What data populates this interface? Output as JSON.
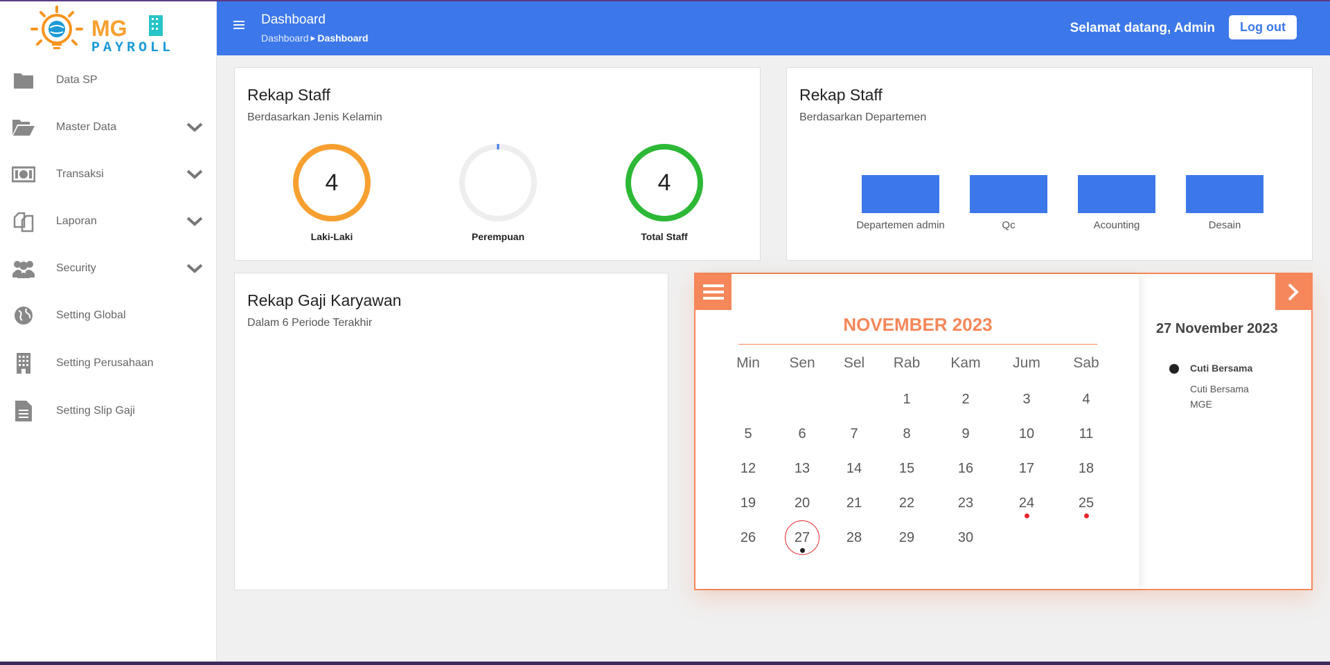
{
  "brand": {
    "logo_text_top": "MG",
    "logo_text_bottom": "PAYROLL",
    "colors": {
      "orange": "#f7941d",
      "blue": "#1b9ad6",
      "teal": "#27c4c8"
    }
  },
  "sidebar": {
    "items": [
      {
        "label": "Data SP",
        "icon": "folder-icon",
        "has_chevron": false
      },
      {
        "label": "Master Data",
        "icon": "folder-open-icon",
        "has_chevron": true
      },
      {
        "label": "Transaksi",
        "icon": "money-icon",
        "has_chevron": true
      },
      {
        "label": "Laporan",
        "icon": "copy-icon",
        "has_chevron": true
      },
      {
        "label": "Security",
        "icon": "users-icon",
        "has_chevron": true
      },
      {
        "label": "Setting Global",
        "icon": "globe-icon",
        "has_chevron": false
      },
      {
        "label": "Setting Perusahaan",
        "icon": "building-icon",
        "has_chevron": false
      },
      {
        "label": "Setting Slip Gaji",
        "icon": "file-text-icon",
        "has_chevron": false
      }
    ]
  },
  "header": {
    "title": "Dashboard",
    "breadcrumb": [
      "Dashboard",
      "Dashboard"
    ],
    "welcome": "Selamat datang, Admin",
    "logout_label": "Log out",
    "color": "#3d78ea"
  },
  "staff_gender": {
    "title": "Rekap Staff",
    "subtitle": "Berdasarkan Jenis Kelamin",
    "donuts": [
      {
        "label": "Laki-Laki",
        "value": "4",
        "color": "#f7a030",
        "fraction": 1
      },
      {
        "label": "Perempuan",
        "value": "",
        "color": "#3d78ea",
        "fraction": 0
      },
      {
        "label": "Total Staff",
        "value": "4",
        "color": "#2db836",
        "fraction": 1
      }
    ]
  },
  "staff_dept": {
    "title": "Rekap Staff",
    "subtitle": "Berdasarkan Departemen",
    "chart_data": {
      "type": "bar",
      "categories": [
        "Departemen admin",
        "Qc",
        "Acounting",
        "Desain"
      ],
      "values": [
        1,
        1,
        1,
        1
      ],
      "color": "#3d78ea"
    }
  },
  "salary": {
    "title": "Rekap Gaji Karyawan",
    "subtitle": "Dalam 6 Periode Terakhir"
  },
  "calendar": {
    "month_title": "NOVEMBER 2023",
    "weekdays": [
      "Min",
      "Sen",
      "Sel",
      "Rab",
      "Kam",
      "Jum",
      "Sab"
    ],
    "first_weekday_index": 3,
    "days_in_month": 30,
    "today": 27,
    "marked_days": [
      {
        "day": 24,
        "color": "red"
      },
      {
        "day": 25,
        "color": "red"
      },
      {
        "day": 27,
        "color": "black"
      }
    ],
    "accent": "#f5875a",
    "selected_date": "27 November 2023",
    "event": {
      "title": "Cuti Bersama",
      "description_lines": [
        "Cuti Bersama",
        "MGE"
      ]
    }
  }
}
